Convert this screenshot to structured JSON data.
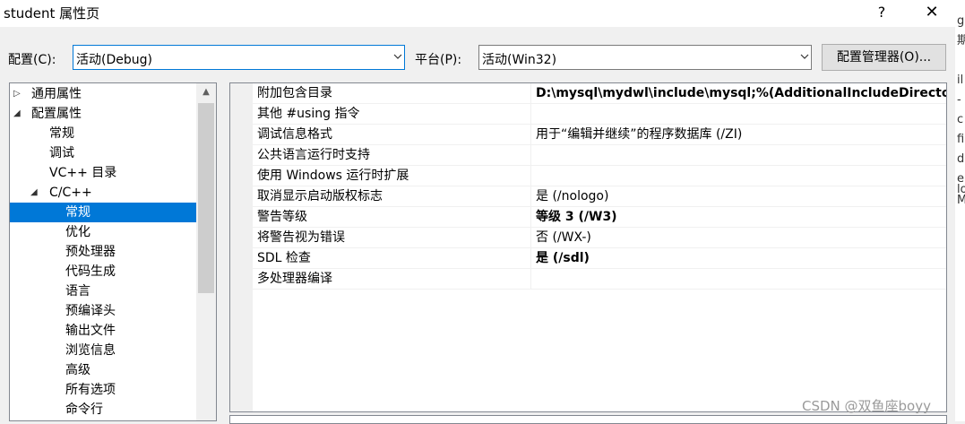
{
  "window": {
    "title": "student 属性页",
    "help_glyph": "?",
    "close_glyph": "✕"
  },
  "background_fragments": [
    "g",
    "期",
    "il",
    "-",
    "c",
    "fi",
    "d",
    "e",
    "lo",
    "M"
  ],
  "toolbar": {
    "config_label": "配置(C):",
    "config_value": "活动(Debug)",
    "platform_label": "平台(P):",
    "platform_value": "活动(Win32)",
    "manager_button": "配置管理器(O)..."
  },
  "tree": {
    "items": [
      {
        "label": "通用属性",
        "expander": "▷",
        "level": 0,
        "selected": false
      },
      {
        "label": "配置属性",
        "expander": "◢",
        "level": 0,
        "selected": false
      },
      {
        "label": "常规",
        "expander": "",
        "level": 1,
        "selected": false
      },
      {
        "label": "调试",
        "expander": "",
        "level": 1,
        "selected": false
      },
      {
        "label": "VC++ 目录",
        "expander": "",
        "level": 1,
        "selected": false
      },
      {
        "label": "C/C++",
        "expander": "◢",
        "level": 1,
        "selected": false
      },
      {
        "label": "常规",
        "expander": "",
        "level": 2,
        "selected": true
      },
      {
        "label": "优化",
        "expander": "",
        "level": 2,
        "selected": false
      },
      {
        "label": "预处理器",
        "expander": "",
        "level": 2,
        "selected": false
      },
      {
        "label": "代码生成",
        "expander": "",
        "level": 2,
        "selected": false
      },
      {
        "label": "语言",
        "expander": "",
        "level": 2,
        "selected": false
      },
      {
        "label": "预编译头",
        "expander": "",
        "level": 2,
        "selected": false
      },
      {
        "label": "输出文件",
        "expander": "",
        "level": 2,
        "selected": false
      },
      {
        "label": "浏览信息",
        "expander": "",
        "level": 2,
        "selected": false
      },
      {
        "label": "高级",
        "expander": "",
        "level": 2,
        "selected": false
      },
      {
        "label": "所有选项",
        "expander": "",
        "level": 2,
        "selected": false
      },
      {
        "label": "命令行",
        "expander": "",
        "level": 2,
        "selected": false
      }
    ],
    "scroll_up_glyph": "▲"
  },
  "properties": [
    {
      "name": "附加包含目录",
      "value": "D:\\mysql\\mydwl\\include\\mysql;%(AdditionalIncludeDirectories)",
      "bold": true
    },
    {
      "name": "其他 #using 指令",
      "value": "",
      "bold": false
    },
    {
      "name": "调试信息格式",
      "value": "用于“编辑并继续”的程序数据库 (/ZI)",
      "bold": false
    },
    {
      "name": "公共语言运行时支持",
      "value": "",
      "bold": false
    },
    {
      "name": "使用 Windows 运行时扩展",
      "value": "",
      "bold": false
    },
    {
      "name": "取消显示启动版权标志",
      "value": "是 (/nologo)",
      "bold": false
    },
    {
      "name": "警告等级",
      "value": "等级 3 (/W3)",
      "bold": true
    },
    {
      "name": "将警告视为错误",
      "value": "否 (/WX-)",
      "bold": false
    },
    {
      "name": "SDL 检查",
      "value": "是 (/sdl)",
      "bold": true
    },
    {
      "name": "多处理器编译",
      "value": "",
      "bold": false
    }
  ],
  "watermark": "CSDN @双鱼座boyy",
  "colors": {
    "selection": "#0078d7",
    "window_bg": "#f0f0f0"
  }
}
